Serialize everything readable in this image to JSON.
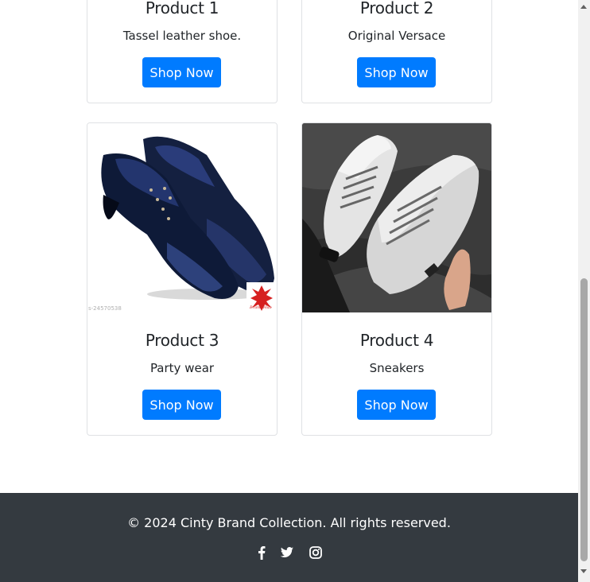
{
  "products": [
    {
      "title": "Product 1",
      "description": "Tassel leather shoe.",
      "button": "Shop Now"
    },
    {
      "title": "Product 2",
      "description": "Original Versace",
      "button": "Shop Now"
    },
    {
      "title": "Product 3",
      "description": "Party wear",
      "button": "Shop Now",
      "image_watermark": "s-24570538",
      "logo_text": "Brand Hub"
    },
    {
      "title": "Product 4",
      "description": "Sneakers",
      "button": "Shop Now"
    }
  ],
  "footer": {
    "copyright": "© 2024 Cinty Brand Collection. All rights reserved.",
    "social_icons": [
      "facebook-icon",
      "twitter-icon",
      "instagram-icon"
    ]
  },
  "colors": {
    "primary": "#007bff",
    "footer_bg": "#343a40",
    "card_border": "#dfe1e4"
  }
}
